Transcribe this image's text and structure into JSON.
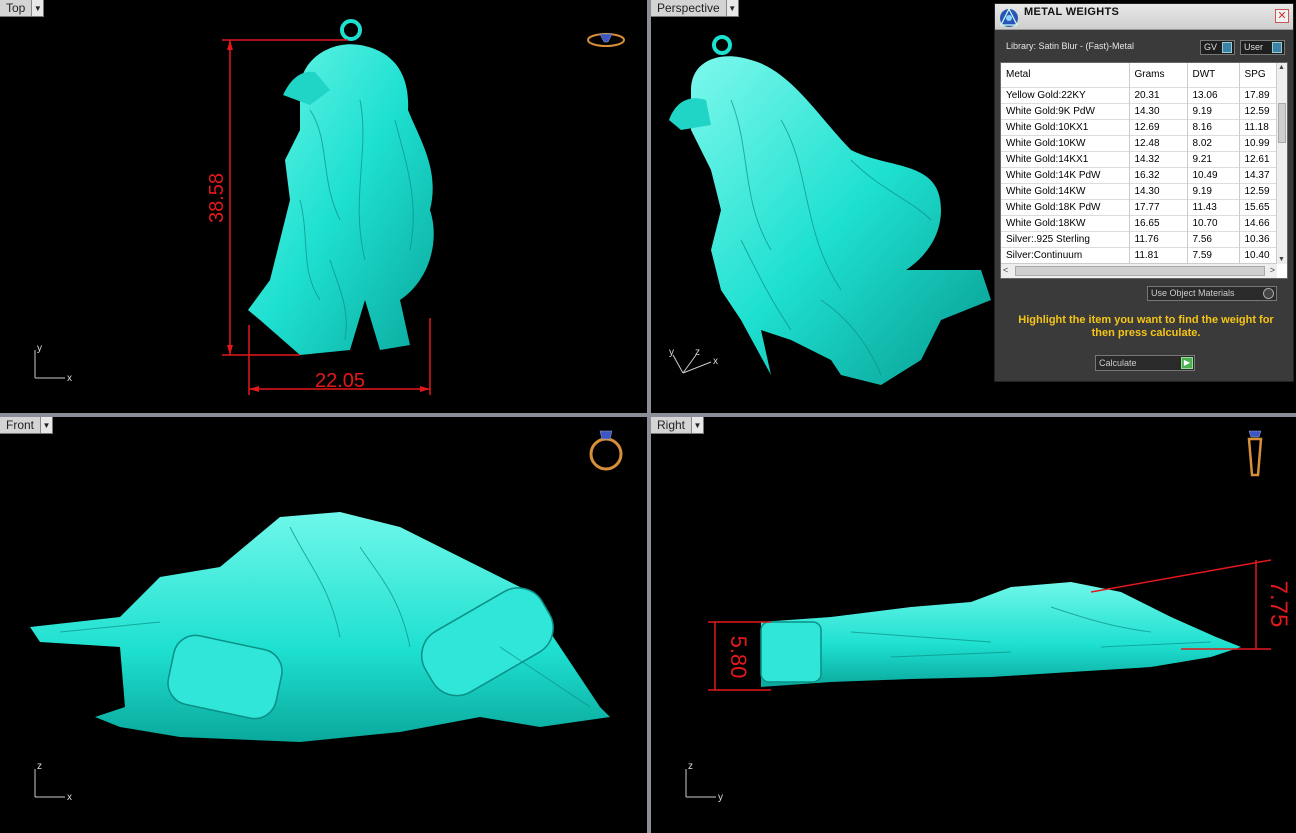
{
  "viewports": {
    "top": {
      "label": "Top",
      "width_dim": "22.05",
      "height_dim": "38.58",
      "axis_x": "x",
      "axis_y": "y"
    },
    "perspective": {
      "label": "Perspective",
      "axis_x": "x",
      "axis_y": "y",
      "axis_z": "z"
    },
    "front": {
      "label": "Front",
      "axis_x": "x",
      "axis_y": "z"
    },
    "right": {
      "label": "Right",
      "dim_left": "5.80",
      "dim_right": "7.75",
      "axis_x": "y",
      "axis_y": "z"
    }
  },
  "metal_weights": {
    "title": "METAL WEIGHTS",
    "close_icon": "close-icon",
    "library": "Library: Satin Blur - (Fast)-Metal",
    "gv_label": "GV",
    "user_label": "User",
    "columns": [
      "Metal",
      "Grams",
      "DWT",
      "SPG"
    ],
    "rows": [
      [
        "Yellow Gold:22KY",
        "20.31",
        "13.06",
        "17.89"
      ],
      [
        "White Gold:9K PdW",
        "14.30",
        "9.19",
        "12.59"
      ],
      [
        "White Gold:10KX1",
        "12.69",
        "8.16",
        "11.18"
      ],
      [
        "White Gold:10KW",
        "12.48",
        "8.02",
        "10.99"
      ],
      [
        "White Gold:14KX1",
        "14.32",
        "9.21",
        "12.61"
      ],
      [
        "White Gold:14K PdW",
        "16.32",
        "10.49",
        "14.37"
      ],
      [
        "White Gold:14KW",
        "14.30",
        "9.19",
        "12.59"
      ],
      [
        "White Gold:18K PdW",
        "17.77",
        "11.43",
        "15.65"
      ],
      [
        "White Gold:18KW",
        "16.65",
        "10.70",
        "14.66"
      ],
      [
        "Silver:.925 Sterling",
        "11.76",
        "7.56",
        "10.36"
      ],
      [
        "Silver:Continuum",
        "11.81",
        "7.59",
        "10.40"
      ]
    ],
    "use_object_materials": "Use Object Materials",
    "hint": "Highlight the item you want to find the weight for then press calculate.",
    "calculate_label": "Calculate"
  },
  "colors": {
    "model": "#1ee0d0",
    "dimension": "#e4181c",
    "hint": "#f5c518",
    "viewport_bg": "#000000"
  }
}
